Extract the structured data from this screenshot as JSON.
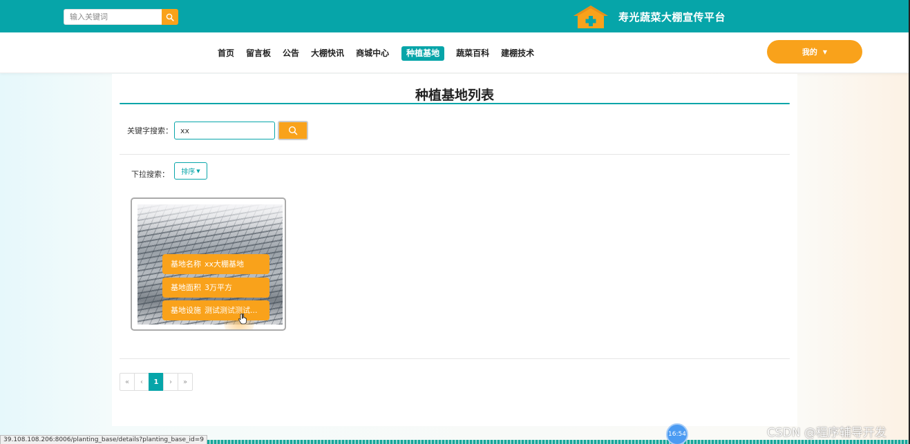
{
  "header": {
    "search_placeholder": "输入关键词",
    "brand_title": "寿光蔬菜大棚宣传平台",
    "accent_color": "#06a5a9",
    "orange_color": "#f9a21b"
  },
  "nav": {
    "items": [
      {
        "label": "首页"
      },
      {
        "label": "留言板"
      },
      {
        "label": "公告"
      },
      {
        "label": "大棚快讯"
      },
      {
        "label": "商城中心"
      },
      {
        "label": "种植基地",
        "active": true
      },
      {
        "label": "蔬菜百科"
      },
      {
        "label": "建棚技术"
      }
    ],
    "user_menu_label": "我的"
  },
  "main": {
    "page_title": "种植基地列表",
    "keyword_label": "关键字搜索：",
    "keyword_value": "xx",
    "dropdown_label": "下拉搜索：",
    "sort_label": "排序",
    "cards": [
      {
        "name_key": "基地名称",
        "name_value": "xx大棚基地",
        "area_key": "基地面积",
        "area_value": "3万平方",
        "facility_key": "基地设施",
        "facility_value": "测试测试测试..."
      }
    ],
    "pagination": {
      "first": "«",
      "prev": "‹",
      "current": "1",
      "next": "›",
      "last": "»"
    }
  },
  "overlay": {
    "status_url": "39.108.108.206:8006/planting_base/details?planting_base_id=9",
    "clock_time": "16:54",
    "watermark": "CSDN @程序辅导开发"
  }
}
